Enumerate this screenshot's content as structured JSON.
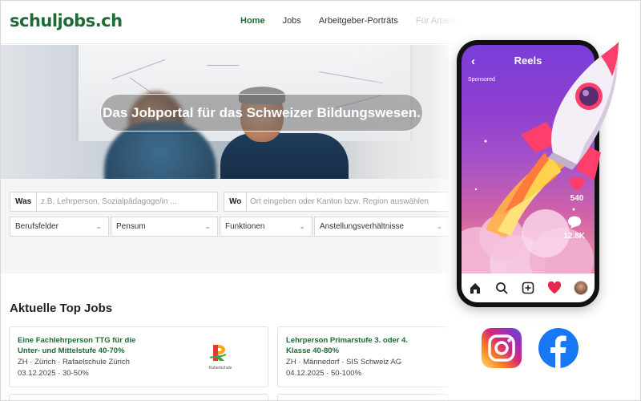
{
  "header": {
    "logo": "schuljobs.ch",
    "nav": [
      "Home",
      "Jobs",
      "Arbeitgeber-Porträts",
      "Für Arbeitg"
    ]
  },
  "hero": {
    "tagline": "Das Jobportal für das Schweizer Bildungswesen."
  },
  "search": {
    "what_label": "Was",
    "what_placeholder": "z.B. Lehrperson, Sozialpädagoge/in ...",
    "where_label": "Wo",
    "where_placeholder": "Ort eingeben oder Kanton bzw. Region auswählen",
    "filters": [
      "Berufsfelder",
      "Pensum",
      "Funktionen",
      "Anstellungsverhältnisse"
    ]
  },
  "top_jobs": {
    "title": "Aktuelle Top Jobs",
    "jobs": [
      {
        "title_line1": "Eine Fachlehrperson TTG für die",
        "title_line2": "Unter- und Mittelstufe 40-70%",
        "location": "ZH · Zürich · Rafaelschule Zürich",
        "date_pensum": "03.12.2025 · 30-50%",
        "logo_text": "Rafaelschule"
      },
      {
        "title_line1": "Lehrperson Primarstufe 3. oder 4.",
        "title_line2": "Klasse 40-80%",
        "location": "ZH · Männedorf · SIS Schweiz AG",
        "date_pensum": "04.12.2025 · 50-100%"
      }
    ]
  },
  "phone": {
    "title": "Reels",
    "sponsored": "Sponsored",
    "likes": "540",
    "comments": "12.8K"
  },
  "colors": {
    "brand_green": "#1d6b33",
    "instagram": "#d6249f",
    "facebook": "#1877f2"
  },
  "social": [
    "instagram-icon",
    "facebook-icon"
  ]
}
